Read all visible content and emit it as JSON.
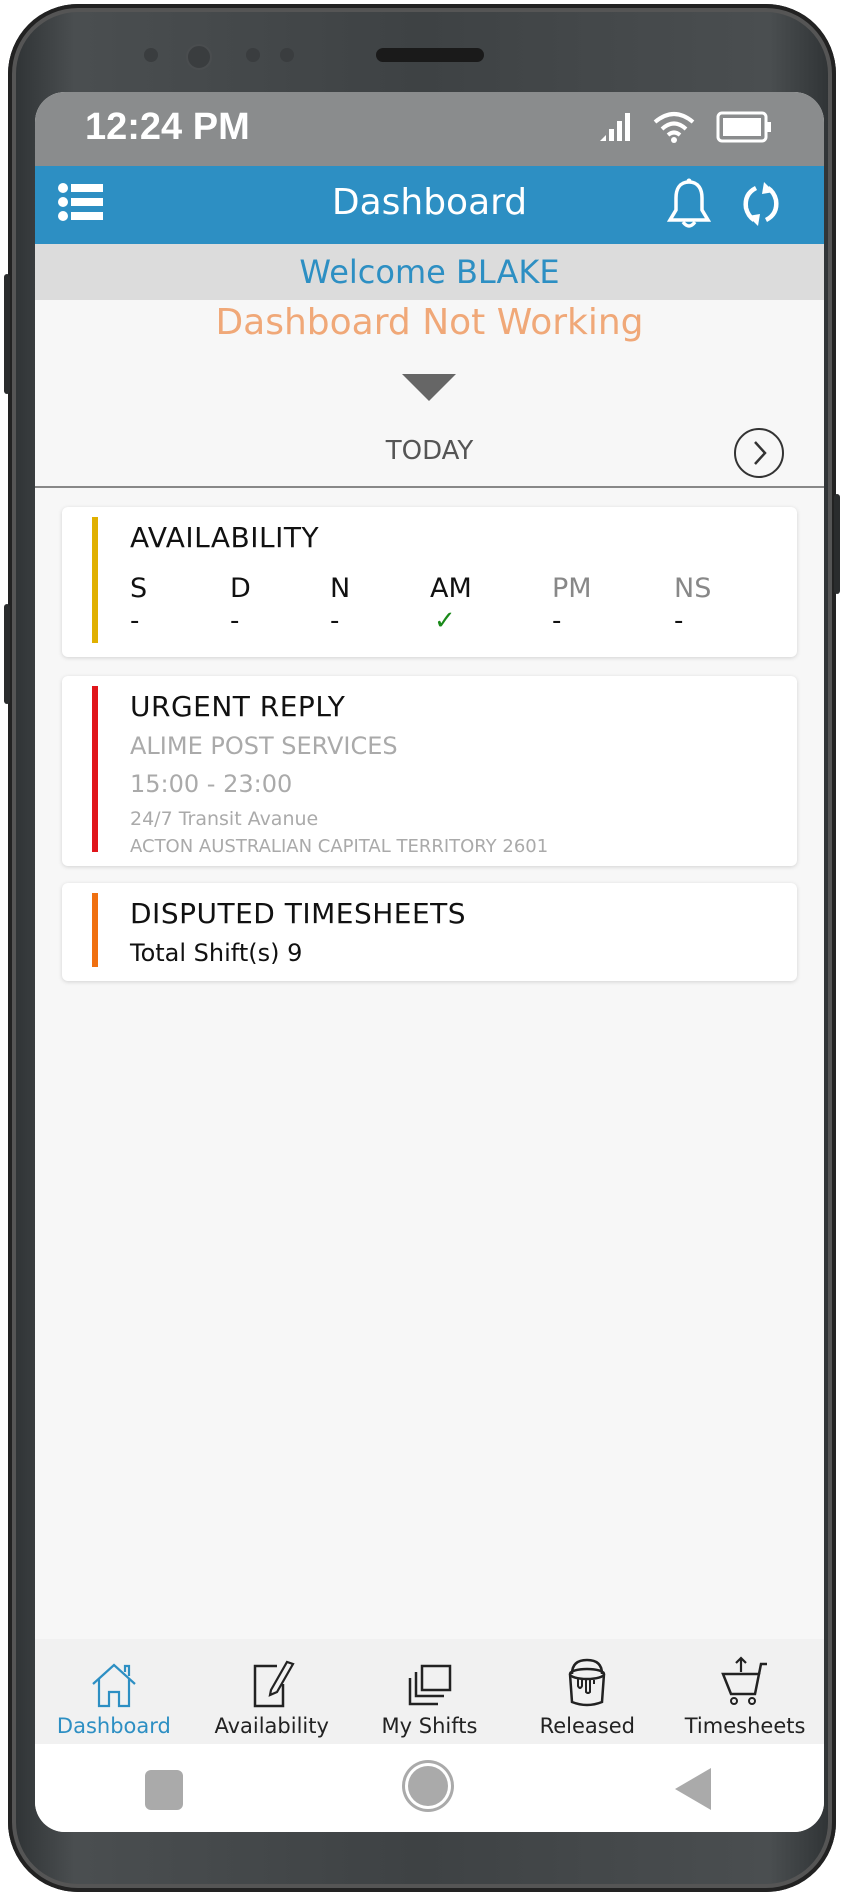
{
  "status_bar": {
    "time": "12:24 PM",
    "icons": [
      "signal-icon",
      "wifi-icon",
      "battery-icon"
    ]
  },
  "header": {
    "title": "Dashboard",
    "icons": [
      "menu-list-icon",
      "bell-icon",
      "sync-icon"
    ]
  },
  "welcome": "Welcome BLAKE",
  "notice": "Dashboard Not Working",
  "date_nav": {
    "label": "TODAY"
  },
  "colors": {
    "brand": "#2d8fc3",
    "notice": "#f0a878",
    "availability_bar": "#e0b000",
    "urgent_bar": "#e0151b",
    "disputed_bar": "#f07010",
    "check": "#1a8a1a"
  },
  "cards": {
    "availability": {
      "title": "AVAILABILITY",
      "columns": [
        {
          "key": "S",
          "value": "-"
        },
        {
          "key": "D",
          "value": "-"
        },
        {
          "key": "N",
          "value": "-"
        },
        {
          "key": "AM",
          "value": "✓"
        },
        {
          "key": "PM",
          "value": "-"
        },
        {
          "key": "NS",
          "value": "-"
        }
      ]
    },
    "urgent_reply": {
      "title": "URGENT REPLY",
      "company": "ALIME POST SERVICES",
      "time": "15:00 - 23:00",
      "address_line1": "24/7 Transit Avanue",
      "address_line2": "ACTON AUSTRALIAN CAPITAL TERRITORY 2601"
    },
    "disputed": {
      "title": "DISPUTED TIMESHEETS",
      "summary": "Total Shift(s) 9"
    }
  },
  "bottom_nav": [
    {
      "label": "Dashboard",
      "icon": "home-icon",
      "active": true
    },
    {
      "label": "Availability",
      "icon": "edit-note-icon",
      "active": false
    },
    {
      "label": "My Shifts",
      "icon": "stack-icon",
      "active": false
    },
    {
      "label": "Released",
      "icon": "paint-bucket-icon",
      "active": false
    },
    {
      "label": "Timesheets",
      "icon": "cart-upload-icon",
      "active": false
    }
  ]
}
